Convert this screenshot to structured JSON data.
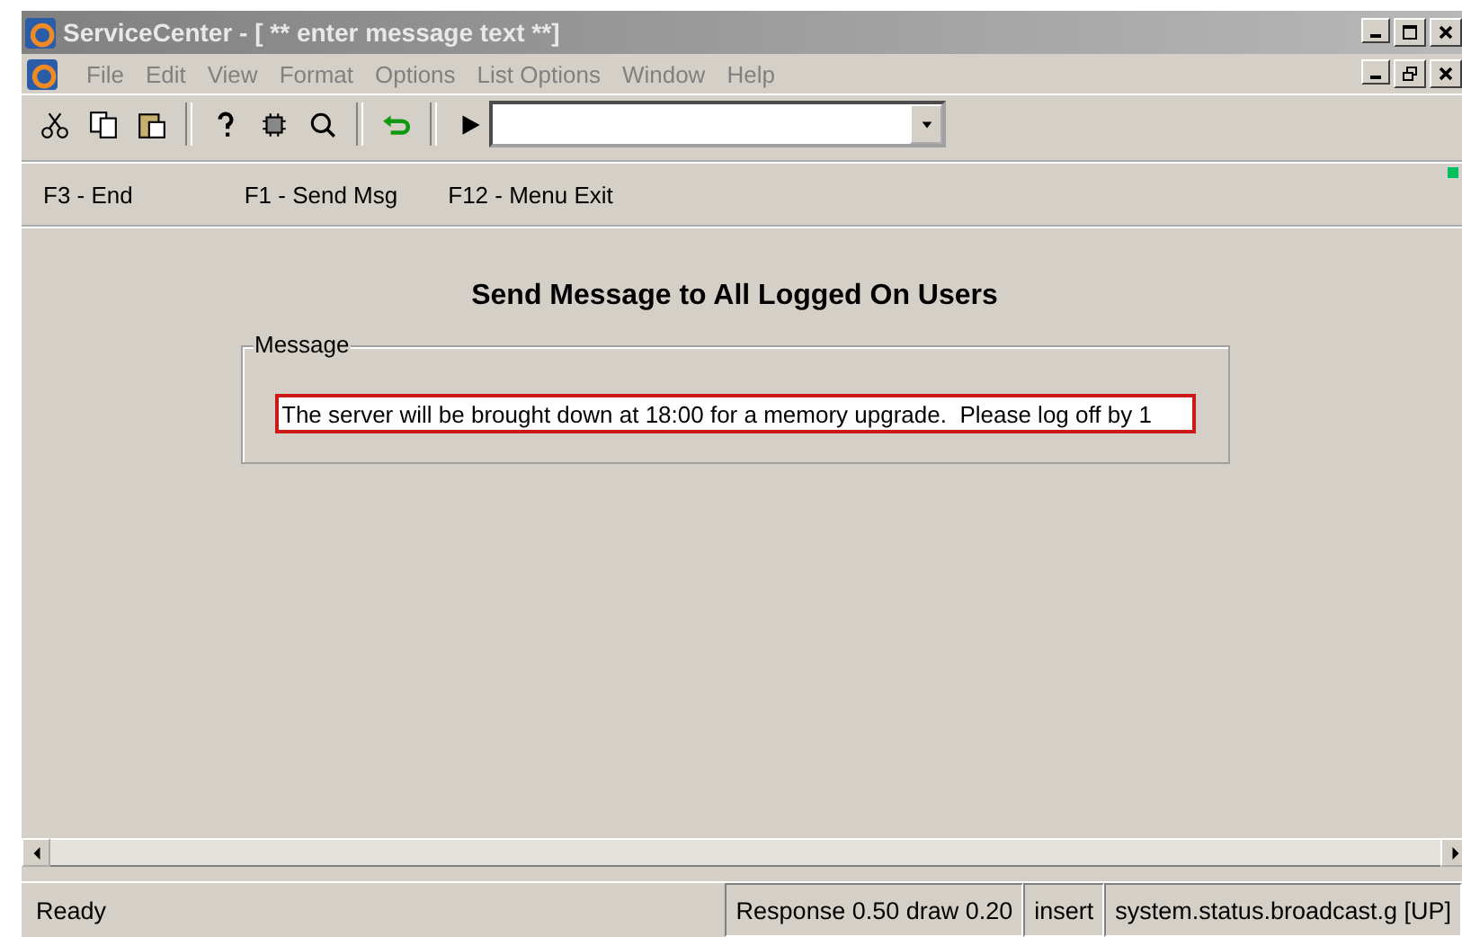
{
  "window": {
    "title": "ServiceCenter - [ ** enter message text **]"
  },
  "menu": [
    {
      "label": "File",
      "disabled": true
    },
    {
      "label": "Edit",
      "disabled": true
    },
    {
      "label": "View",
      "disabled": true
    },
    {
      "label": "Format",
      "disabled": true
    },
    {
      "label": "Options",
      "disabled": true
    },
    {
      "label": "List Options",
      "disabled": true
    },
    {
      "label": "Window",
      "disabled": true
    },
    {
      "label": "Help",
      "disabled": true
    }
  ],
  "function_keys": [
    "F3 - End",
    "F1 - Send Msg",
    "F12 - Menu Exit"
  ],
  "form": {
    "heading": "Send Message to All Logged On Users",
    "group_label": "Message",
    "message": {
      "value": "The server will be brought down at 18:00 for a memory upgrade.  Please log off by 1",
      "focused": true
    }
  },
  "status_bar": [
    "Ready",
    "Response 0.50 draw 0.20",
    "insert",
    "system.status.broadcast.g [UP]"
  ]
}
